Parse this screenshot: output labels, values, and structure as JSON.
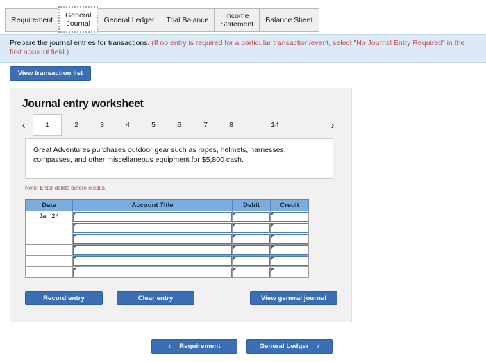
{
  "tabs": [
    {
      "label": "Requirement",
      "active": false
    },
    {
      "label": "General Journal",
      "line1": "General",
      "line2": "Journal",
      "active": true
    },
    {
      "label": "General Ledger",
      "active": false
    },
    {
      "label": "Trial Balance",
      "active": false
    },
    {
      "label": "Income Statement",
      "line1": "Income",
      "line2": "Statement",
      "active": false
    },
    {
      "label": "Balance Sheet",
      "active": false
    }
  ],
  "banner": {
    "text_black": "Prepare the journal entries for transactions.",
    "text_red": "(If no entry is required for a particular transaction/event, select \"No Journal Entry Required\" in the first account field.)"
  },
  "toolbar": {
    "view_transaction_list": "View transaction list"
  },
  "worksheet": {
    "title": "Journal entry worksheet",
    "pagination": {
      "prev_icon": "chevron-left-icon",
      "next_icon": "chevron-right-icon",
      "pages": [
        "1",
        "2",
        "3",
        "4",
        "5",
        "6",
        "7",
        "8",
        "14"
      ],
      "active_page": "1"
    },
    "description": "Great Adventures purchases outdoor gear such as ropes, helmets, harnesses, compasses, and other miscellaneous equipment for $5,800 cash.",
    "note": "Note: Enter debits before credits.",
    "table": {
      "headers": [
        "Date",
        "Account Title",
        "Debit",
        "Credit"
      ],
      "rows": [
        {
          "date": "Jan 24",
          "account": "",
          "debit": "",
          "credit": ""
        },
        {
          "date": "",
          "account": "",
          "debit": "",
          "credit": ""
        },
        {
          "date": "",
          "account": "",
          "debit": "",
          "credit": ""
        },
        {
          "date": "",
          "account": "",
          "debit": "",
          "credit": ""
        },
        {
          "date": "",
          "account": "",
          "debit": "",
          "credit": ""
        },
        {
          "date": "",
          "account": "",
          "debit": "",
          "credit": ""
        }
      ]
    },
    "buttons": {
      "record_entry": "Record entry",
      "clear_entry": "Clear entry",
      "view_general_journal": "View general journal"
    }
  },
  "footer_nav": {
    "prev_label": "Requirement",
    "prev_icon": "chevron-left-icon",
    "next_label": "General Ledger",
    "next_icon": "chevron-right-icon"
  },
  "colors": {
    "accent_blue": "#3a6fb5",
    "banner_bg": "#dce9f6",
    "banner_red": "#c0504d",
    "table_header_blue": "#7cabdd",
    "panel_bg": "#f1f1f1",
    "note_red": "#b1403e"
  }
}
